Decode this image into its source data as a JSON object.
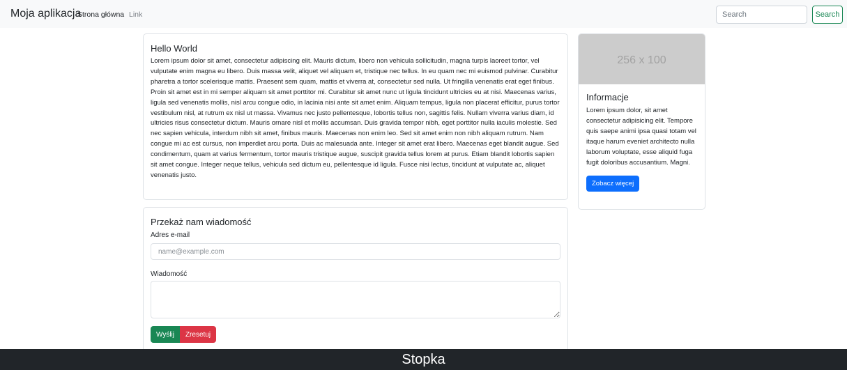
{
  "navbar": {
    "brand": "Moja aplikacja",
    "links": [
      "Strona główna",
      "Link"
    ],
    "search_placeholder": "Search",
    "search_button": "Search",
    "accent": "#198754"
  },
  "main": {
    "hello_card": {
      "title": "Hello World",
      "text": "Lorem ipsum dolor sit amet, consectetur adipiscing elit. Mauris dictum, libero non vehicula sollicitudin, magna turpis laoreet tortor, vel vulputate enim magna eu libero. Duis massa velit, aliquet vel aliquam et, tristique nec tellus. In eu quam nec mi euismod pulvinar. Curabitur pharetra a tortor scelerisque mattis. Praesent sem quam, mattis et viverra at, consectetur sed nulla. Ut fringilla venenatis erat eget finibus. Proin sit amet est in mi semper aliquam sit amet porttitor mi. Curabitur sit amet nunc ut ligula tincidunt ultricies eu at nisi. Maecenas varius, ligula sed venenatis mollis, nisl arcu congue odio, in lacinia nisi ante sit amet enim. Aliquam tempus, ligula non placerat efficitur, purus tortor vestibulum nisl, at rutrum ex nisl ut massa. Vivamus nec justo pellentesque, lobortis tellus non, sagittis felis. Nullam viverra varius diam, id ultricies risus consectetur dictum. Mauris ornare nisl et mollis accumsan. Duis gravida tempor nibh, eget porttitor nulla iaculis molestie. Sed nec sapien vehicula, interdum nibh sit amet, finibus mauris. Maecenas non enim leo. Sed sit amet enim non nibh aliquam rutrum. Nam congue mi ac est cursus, non imperdiet arcu porta. Duis ac malesuada ante. Integer sit amet erat libero. Maecenas eget blandit augue. Sed condimentum, quam at varius fermentum, tortor mauris tristique augue, suscipit gravida tellus lorem at purus. Etiam blandit lobortis sapien sit amet congue. Integer neque tellus, vehicula sed dictum eu, pellentesque id ligula. Fusce nisi lectus, tincidunt at vulputate ac, aliquet venenatis justo."
    },
    "form": {
      "title": "Przekaż nam wiadomość",
      "email_label": "Adres e-mail",
      "email_placeholder": "name@example.com",
      "message_label": "Wiadomość",
      "send_button": "Wyślij",
      "reset_button": "Zresetuj",
      "send_color": "#198754",
      "reset_color": "#dc3545"
    }
  },
  "sidebar": {
    "image_placeholder": "256 x 100",
    "title": "Informacje",
    "text": "Lorem ipsum dolor, sit amet consectetur adipisicing elit. Tempore quis saepe animi ipsa quasi totam vel itaque harum eveniet architecto nulla laborum voluptate, esse aliquid fuga fugit doloribus accusantium. Magni.",
    "button": "Zobacz więcej",
    "button_color": "#0d6efd"
  },
  "footer": {
    "text": "Stopka"
  }
}
